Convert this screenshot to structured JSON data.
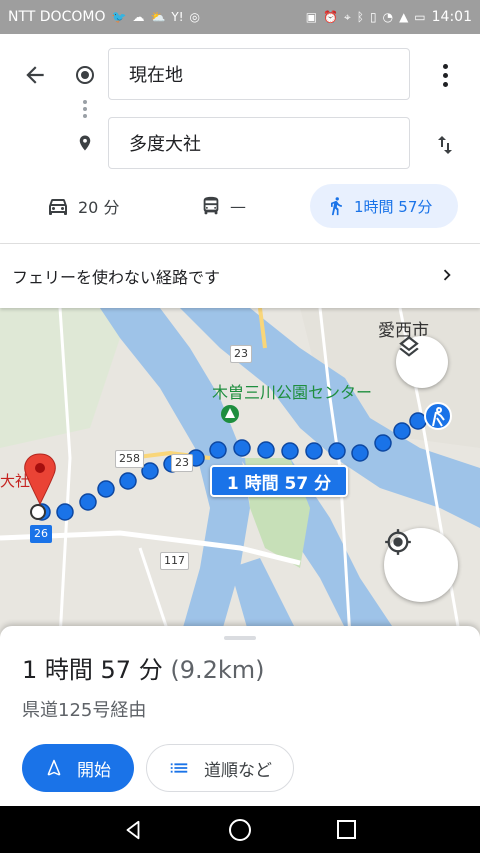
{
  "status_bar": {
    "carrier": "NTT DOCOMO",
    "time": "14:01",
    "left_icons": [
      "twitter-icon",
      "cloud-icon",
      "weather-icon",
      "yahoo-icon",
      "app-icon"
    ],
    "right_icons": [
      "screenshot-icon",
      "alarm-icon",
      "location-icon",
      "bluetooth-icon",
      "vibrate-icon",
      "wifi-icon",
      "signal-icon",
      "battery-icon"
    ]
  },
  "directions": {
    "origin_value": "現在地",
    "destination_value": "多度大社"
  },
  "modes": {
    "car_label": "20 分",
    "transit_label": "—",
    "walk_label": "1時間 57分",
    "selected": "walk"
  },
  "notice": {
    "text": "フェリーを使わない経路です"
  },
  "map": {
    "city_label": "愛西市",
    "park_label": "木曽三川公園センター",
    "dest_label_partial": "大社",
    "route_shields": [
      "23",
      "258",
      "23",
      "26",
      "117"
    ],
    "route_duration": "1 時間 57 分"
  },
  "summary": {
    "duration": "1 時間 57 分",
    "distance": "(9.2km)",
    "via": "県道125号経由"
  },
  "actions": {
    "start_label": "開始",
    "steps_label": "道順など"
  },
  "colors": {
    "accent": "#1a73e8",
    "route": "#1a73e8",
    "pin": "#d93025",
    "park": "#1e8e3e"
  }
}
